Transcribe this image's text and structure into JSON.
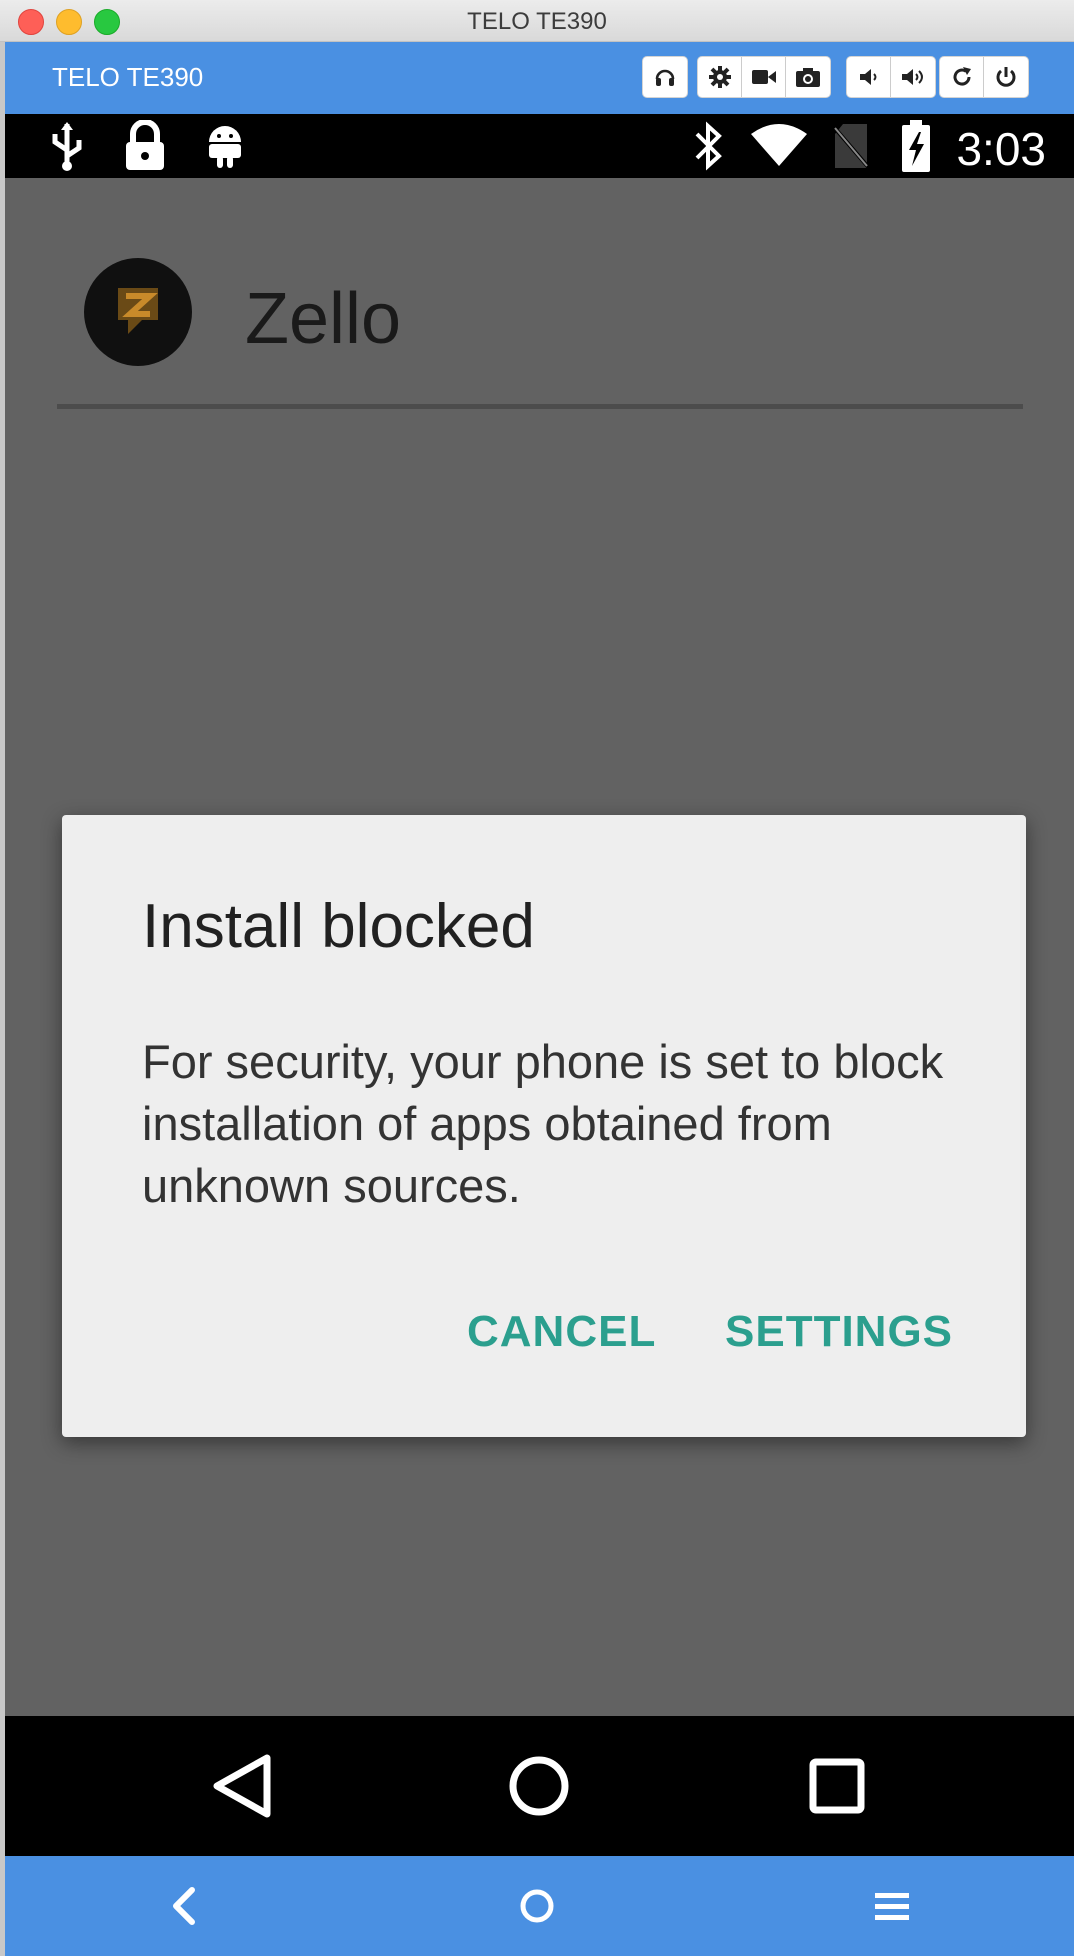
{
  "window": {
    "title": "TELO TE390"
  },
  "toolbar": {
    "device_name": "TELO TE390",
    "buttons": [
      "headphones-icon",
      "gear-icon",
      "video-camera-icon",
      "camera-icon",
      "volume-down-icon",
      "volume-up-icon",
      "rotate-icon",
      "power-icon"
    ]
  },
  "status_bar": {
    "time": "3:03",
    "left_icons": [
      "usb-icon",
      "lock-icon",
      "android-icon"
    ],
    "right_icons": [
      "bluetooth-icon",
      "wifi-icon",
      "no-sim-icon",
      "battery-charging-icon"
    ]
  },
  "app": {
    "name": "Zello"
  },
  "dialog": {
    "title": "Install blocked",
    "message": "For security, your phone is set to block installation of apps obtained from unknown sources.",
    "cancel_label": "CANCEL",
    "settings_label": "SETTINGS"
  },
  "nav_bar": {
    "icons": [
      "back-triangle-icon",
      "home-circle-icon",
      "recents-square-icon"
    ]
  },
  "bottom_bar": {
    "icons": [
      "chevron-left-icon",
      "circle-home-icon",
      "menu-icon"
    ]
  },
  "colors": {
    "toolbar": "#4a90e2",
    "dialog_button": "#2b9f8e",
    "scrim": "#626262"
  }
}
